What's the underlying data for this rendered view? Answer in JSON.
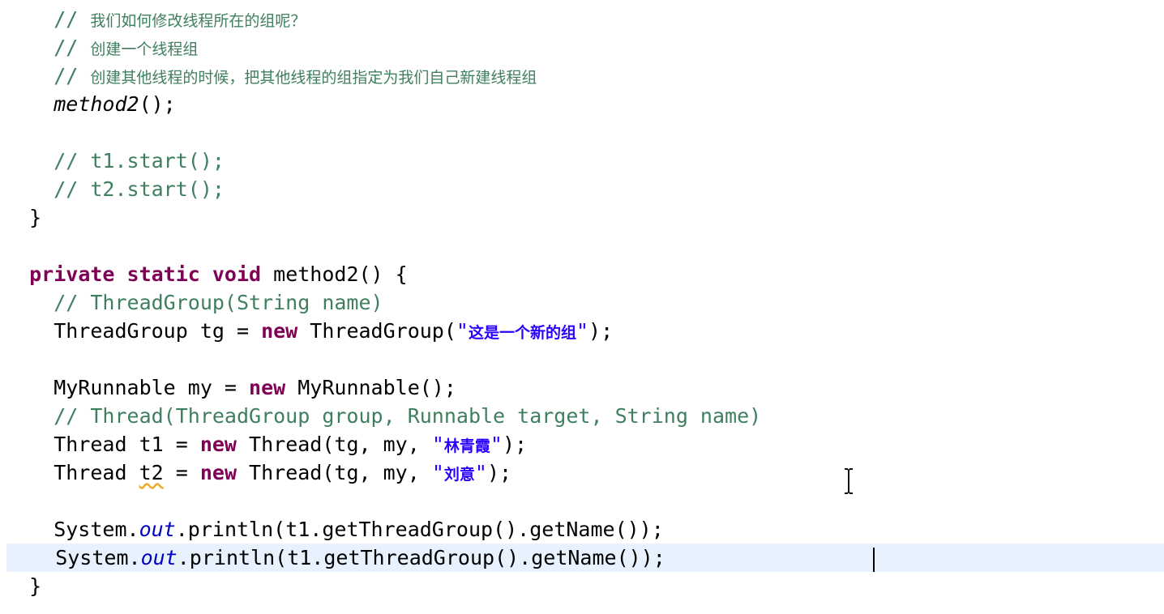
{
  "editor": {
    "lines": [
      {
        "id": "l1",
        "segments": [
          {
            "t": "    // ",
            "cls": "c"
          },
          {
            "t": "我们如何修改线程所在的组呢？",
            "cls": "c cjk"
          }
        ]
      },
      {
        "id": "l2",
        "segments": [
          {
            "t": "    // ",
            "cls": "c"
          },
          {
            "t": "创建一个线程组",
            "cls": "c cjk"
          }
        ]
      },
      {
        "id": "l3",
        "segments": [
          {
            "t": "    // ",
            "cls": "c"
          },
          {
            "t": "创建其他线程的时候，把其他线程的组指定为我们自己新建线程组",
            "cls": "c cjk"
          }
        ]
      },
      {
        "id": "l4",
        "segments": [
          {
            "t": "    "
          },
          {
            "t": "method2",
            "cls": "it"
          },
          {
            "t": "();"
          }
        ]
      },
      {
        "id": "l5",
        "segments": [
          {
            "t": ""
          }
        ]
      },
      {
        "id": "l6",
        "segments": [
          {
            "t": "    // t1.start();",
            "cls": "c"
          }
        ]
      },
      {
        "id": "l7",
        "segments": [
          {
            "t": "    // t2.start();",
            "cls": "c"
          }
        ]
      },
      {
        "id": "l8",
        "segments": [
          {
            "t": "  }"
          }
        ]
      },
      {
        "id": "l9",
        "segments": [
          {
            "t": ""
          }
        ]
      },
      {
        "id": "l10",
        "segments": [
          {
            "t": "  "
          },
          {
            "t": "private static void",
            "cls": "kw"
          },
          {
            "t": " method2() {"
          }
        ]
      },
      {
        "id": "l11",
        "segments": [
          {
            "t": "    // ThreadGroup(String name)",
            "cls": "c"
          }
        ]
      },
      {
        "id": "l12",
        "segments": [
          {
            "t": "    ThreadGroup tg = "
          },
          {
            "t": "new",
            "cls": "kw"
          },
          {
            "t": " ThreadGroup("
          },
          {
            "t": "\"",
            "cls": "str"
          },
          {
            "t": "这是一个新的组",
            "cls": "cjkstr"
          },
          {
            "t": "\"",
            "cls": "str"
          },
          {
            "t": ");"
          }
        ]
      },
      {
        "id": "l13",
        "segments": [
          {
            "t": ""
          }
        ]
      },
      {
        "id": "l14",
        "segments": [
          {
            "t": "    MyRunnable my = "
          },
          {
            "t": "new",
            "cls": "kw"
          },
          {
            "t": " MyRunnable();"
          }
        ]
      },
      {
        "id": "l15",
        "segments": [
          {
            "t": "    // Thread(ThreadGroup group, Runnable target, String name)",
            "cls": "c"
          }
        ]
      },
      {
        "id": "l16",
        "segments": [
          {
            "t": "    Thread t1 = "
          },
          {
            "t": "new",
            "cls": "kw"
          },
          {
            "t": " Thread(tg, my, "
          },
          {
            "t": "\"",
            "cls": "str"
          },
          {
            "t": "林青霞",
            "cls": "cjkstr"
          },
          {
            "t": "\"",
            "cls": "str"
          },
          {
            "t": ");"
          }
        ]
      },
      {
        "id": "l17",
        "segments": [
          {
            "t": "    Thread "
          },
          {
            "t": "t2",
            "cls": "warn"
          },
          {
            "t": " = "
          },
          {
            "t": "new",
            "cls": "kw"
          },
          {
            "t": " Thread(tg, my, "
          },
          {
            "t": "\"",
            "cls": "str"
          },
          {
            "t": "刘意",
            "cls": "cjkstr"
          },
          {
            "t": "\"",
            "cls": "str"
          },
          {
            "t": ");"
          }
        ]
      },
      {
        "id": "l18",
        "segments": [
          {
            "t": ""
          }
        ]
      },
      {
        "id": "l19",
        "segments": [
          {
            "t": "    System."
          },
          {
            "t": "out",
            "cls": "fld"
          },
          {
            "t": ".println(t1.getThreadGroup().getName());"
          }
        ]
      },
      {
        "id": "l20",
        "current": true,
        "segments": [
          {
            "t": "    System."
          },
          {
            "t": "out",
            "cls": "fld"
          },
          {
            "t": ".println(t1.getThreadGroup().getName());"
          }
        ]
      },
      {
        "id": "l21",
        "segments": [
          {
            "t": "  }"
          }
        ]
      }
    ]
  },
  "colors": {
    "keyword": "#7f0055",
    "comment": "#3f7f5f",
    "string": "#2a00ff",
    "static_field": "#0000c0",
    "current_line": "#e8f2fe",
    "warning_underline": "#f5a623"
  },
  "icons": {
    "cursor": "text-ibeam-cursor-icon",
    "caret": "text-caret"
  }
}
